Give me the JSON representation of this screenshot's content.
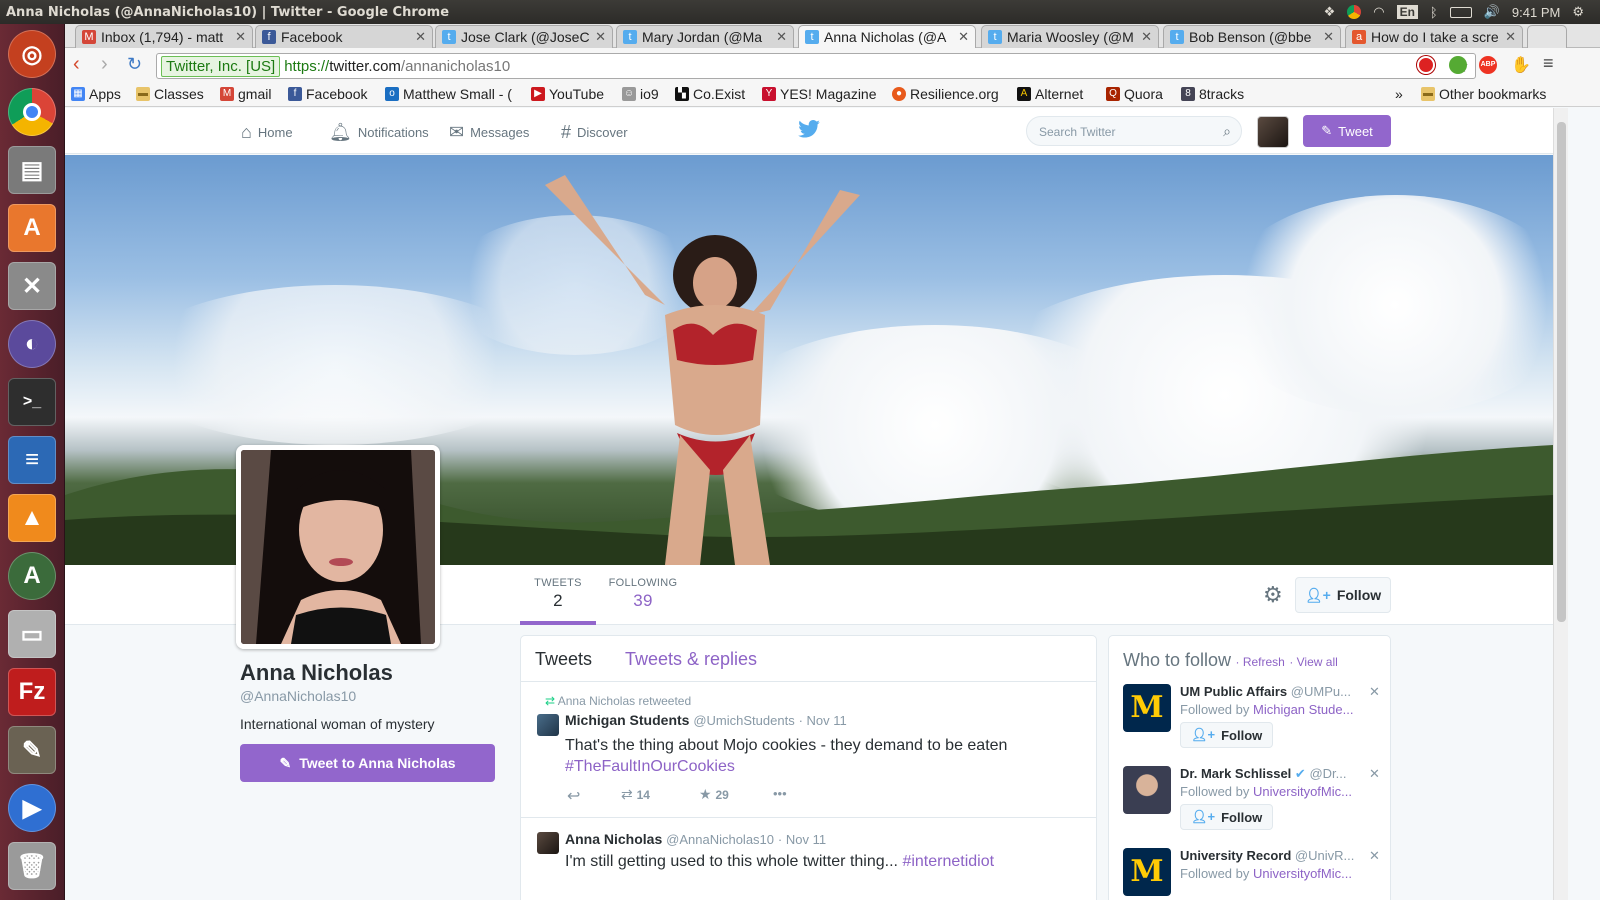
{
  "window": {
    "title": "Anna Nicholas (@AnnaNicholas10) | Twitter - Google Chrome"
  },
  "tray": {
    "lang": "En",
    "time": "9:41 PM"
  },
  "tabs": [
    {
      "label": "Inbox (1,794) - matt",
      "icon": "gmail-icon",
      "color": "#d44638"
    },
    {
      "label": "Facebook",
      "icon": "facebook-icon",
      "color": "#3b5998"
    },
    {
      "label": "Jose Clark (@JoseC",
      "icon": "twitter-icon",
      "color": "#55acee"
    },
    {
      "label": "Mary Jordan (@Ma",
      "icon": "twitter-icon",
      "color": "#55acee"
    },
    {
      "label": "Anna Nicholas (@A",
      "icon": "twitter-icon",
      "color": "#55acee"
    },
    {
      "label": "Maria Woosley (@M",
      "icon": "twitter-icon",
      "color": "#55acee"
    },
    {
      "label": "Bob Benson (@bbe",
      "icon": "twitter-icon",
      "color": "#55acee"
    },
    {
      "label": "How do I take a scre",
      "icon": "ask-icon",
      "color": "#e4572e"
    }
  ],
  "omnibox": {
    "ev": "Twitter, Inc. [US]",
    "scheme": "https://",
    "host": "twitter.com",
    "path": "/annanicholas10"
  },
  "bookmarks": [
    {
      "label": "Apps"
    },
    {
      "label": "Classes"
    },
    {
      "label": "gmail"
    },
    {
      "label": "Facebook"
    },
    {
      "label": "Matthew Small - ("
    },
    {
      "label": "YouTube"
    },
    {
      "label": "io9"
    },
    {
      "label": "Co.Exist"
    },
    {
      "label": "YES! Magazine"
    },
    {
      "label": "Resilience.org"
    },
    {
      "label": "Alternet"
    },
    {
      "label": "Quora"
    },
    {
      "label": "8tracks"
    }
  ],
  "bookmarks_overflow": "»",
  "other_bookmarks": "Other bookmarks",
  "twitter_nav": {
    "home": "Home",
    "notifications": "Notifications",
    "messages": "Messages",
    "discover": "Discover",
    "search_placeholder": "Search Twitter",
    "tweet_button": "Tweet"
  },
  "stats": {
    "tweets_label": "TWEETS",
    "tweets_value": "2",
    "following_label": "FOLLOWING",
    "following_value": "39"
  },
  "follow_button": "Follow",
  "profile": {
    "name": "Anna Nicholas",
    "handle": "@AnnaNicholas10",
    "bio": "International woman of mystery",
    "tweet_to": "Tweet to Anna Nicholas"
  },
  "timeline": {
    "tab_tweets": "Tweets",
    "tab_replies": "Tweets & replies",
    "tweets": [
      {
        "context": "Anna Nicholas retweeted",
        "name": "Michigan Students",
        "handle": "@UmichStudents",
        "time": "· Nov 11",
        "text": "That's the thing about Mojo cookies - they demand to be eaten",
        "hashtag": "#TheFaultInOurCookies",
        "retweets": "14",
        "favorites": "29",
        "more": "•••"
      },
      {
        "name": "Anna Nicholas",
        "handle": "@AnnaNicholas10",
        "time": "· Nov 11",
        "text": "I'm still getting used to this whole twitter thing...",
        "hashtag": "#internetidiot"
      }
    ]
  },
  "who_to_follow": {
    "title": "Who to follow",
    "refresh": "· Refresh",
    "view_all": "· View all",
    "items": [
      {
        "name": "UM Public Affairs",
        "handle": "@UMPu...",
        "followed_by": "Followed by",
        "by": "Michigan Stude...",
        "follow": "Follow"
      },
      {
        "name": "Dr. Mark Schlissel",
        "handle": "@Dr...",
        "followed_by": "Followed by",
        "by": "UniversityofMic...",
        "follow": "Follow"
      },
      {
        "name": "University Record",
        "handle": "@UnivR...",
        "followed_by": "Followed by",
        "by": "UniversityofMic...",
        "follow": "Follow"
      }
    ]
  },
  "colors": {
    "accent": "#9266cc",
    "twitter_blue": "#55acee",
    "launcher": "#5a2430"
  }
}
